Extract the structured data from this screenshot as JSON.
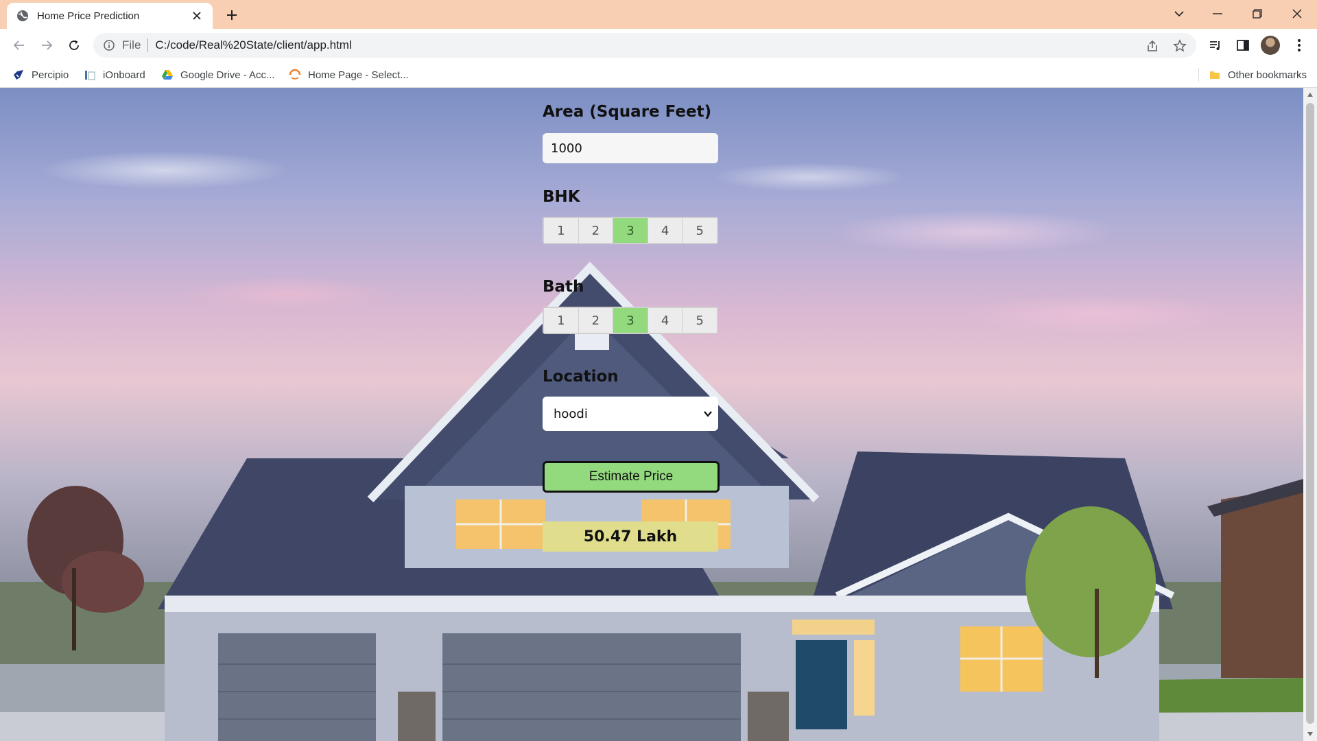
{
  "browser": {
    "tab": {
      "title": "Home Price Prediction"
    },
    "address": {
      "scheme": "File",
      "url": "C:/code/Real%20State/client/app.html"
    },
    "bookmarks": [
      {
        "label": "Percipio"
      },
      {
        "label": "iOnboard"
      },
      {
        "label": "Google Drive - Acc..."
      },
      {
        "label": "Home Page - Select..."
      }
    ],
    "other_bookmarks": "Other bookmarks"
  },
  "form": {
    "area": {
      "label": "Area (Square Feet)",
      "value": "1000"
    },
    "bhk": {
      "label": "BHK",
      "options": [
        "1",
        "2",
        "3",
        "4",
        "5"
      ],
      "selected": "3"
    },
    "bath": {
      "label": "Bath",
      "options": [
        "1",
        "2",
        "3",
        "4",
        "5"
      ],
      "selected": "3"
    },
    "location": {
      "label": "Location",
      "value": "hoodi"
    },
    "estimate_button": "Estimate Price",
    "result": "50.47 Lakh"
  },
  "colors": {
    "tabstrip": "#f9cfb3",
    "selected_option": "#93d97d",
    "result_background": "#e0dd8d"
  }
}
